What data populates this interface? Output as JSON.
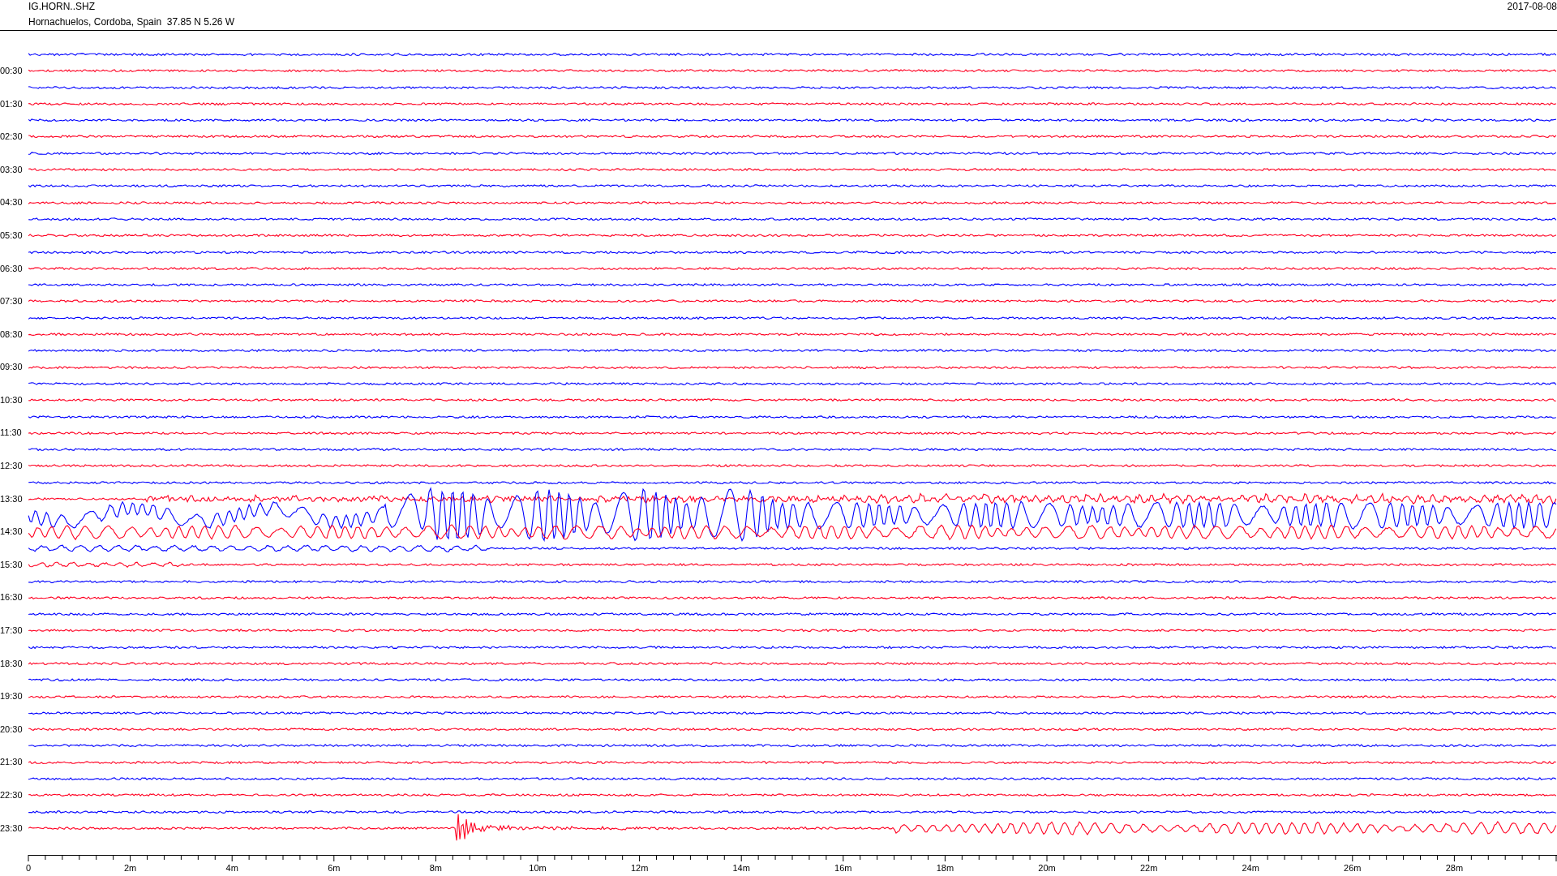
{
  "header": {
    "station": "IG.HORN..SHZ",
    "location": "Hornachuelos, Cordoba, Spain  37.85 N 5.26 W",
    "date": "2017-08-08"
  },
  "helicorder": {
    "trace_labels": [
      "00:30",
      "01:30",
      "02:30",
      "03:30",
      "04:30",
      "05:30",
      "06:30",
      "07:30",
      "08:30",
      "09:30",
      "10:30",
      "11:30",
      "12:30",
      "13:30",
      "14:30",
      "15:30",
      "16:30",
      "17:30",
      "18:30",
      "19:30",
      "20:30",
      "21:30",
      "22:30",
      "23:30"
    ],
    "x_ticks": [
      "0",
      "2m",
      "4m",
      "6m",
      "8m",
      "10m",
      "12m",
      "14m",
      "16m",
      "18m",
      "20m",
      "22m",
      "24m",
      "26m",
      "28m"
    ]
  }
}
